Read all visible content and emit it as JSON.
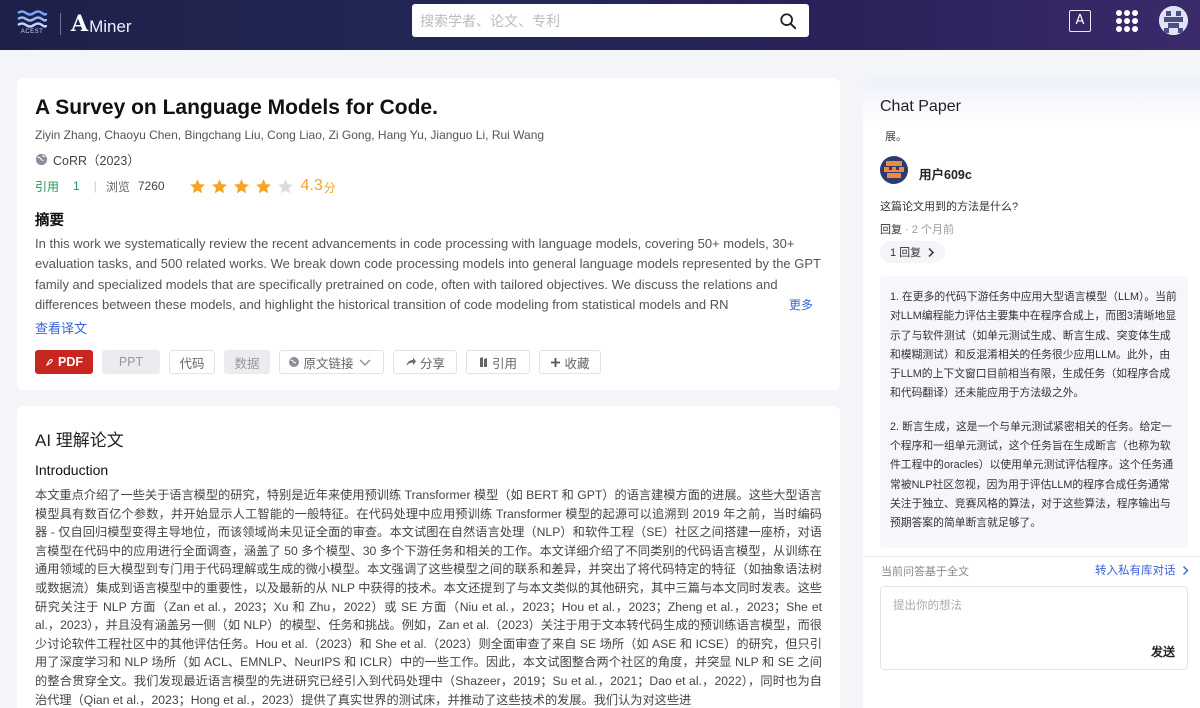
{
  "header": {
    "brand_small": "ACEST",
    "brand_a": "A",
    "brand_name": "Miner",
    "search_placeholder": "搜索学者、论文、专利"
  },
  "paper": {
    "title": "A Survey on Language Models for Code.",
    "authors": [
      "Ziyin Zhang",
      "Chaoyu Chen",
      "Bingchang Liu",
      "Cong Liao",
      "Zi Gong",
      "Hang Yu",
      "Jianguo Li",
      "Rui Wang"
    ],
    "venue": "CoRR（2023）",
    "cite_label": "引用",
    "cite_count": "1",
    "view_label": "浏览",
    "view_count": "7260",
    "rating": 4.3,
    "rating_text": "4.3",
    "rating_unit": "分",
    "stars_filled": 4,
    "stars_total": 5,
    "abstract_heading": "摘要",
    "abstract": "In this work we systematically review the recent advancements in code processing with language models, covering 50+ models, 30+ evaluation tasks, and 500 related works. We break down code processing models into general language models represented by the GPT family and specialized models that are specifically pretrained on code, often with tailored objectives. We discuss the relations and differences between these models, and highlight the historical transition of code modeling from statistical models and RN",
    "more_label": "更多",
    "translate_label": "查看译文",
    "buttons": {
      "pdf": "PDF",
      "ppt": "PPT",
      "code": "代码",
      "data": "数据",
      "source": "原文链接",
      "share": "分享",
      "cite": "引用",
      "favorite": "收藏"
    }
  },
  "ai": {
    "heading": "AI 理解论文",
    "intro_heading": "Introduction",
    "intro_text": "本文重点介绍了一些关于语言模型的研究，特别是近年来使用预训练 Transformer 模型（如 BERT 和 GPT）的语言建模方面的进展。这些大型语言模型具有数百亿个参数，并开始显示人工智能的一般特征。在代码处理中应用预训练 Transformer 模型的起源可以追溯到 2019 年之前，当时编码器 - 仅自回归模型变得主导地位，而该领域尚未见证全面的审查。本文试图在自然语言处理（NLP）和软件工程（SE）社区之间搭建一座桥，对语言模型在代码中的应用进行全面调查，涵盖了 50 多个模型、30 多个下游任务和相关的工作。本文详细介绍了不同类别的代码语言模型，从训练在通用领域的巨大模型到专门用于代码理解或生成的微小模型。本文强调了这些模型之间的联系和差异，并突出了将代码特定的特征（如抽象语法树或数据流）集成到语言模型中的重要性，以及最新的从 NLP 中获得的技术。本文还提到了与本文类似的其他研究，其中三篇与本文同时发表。这些研究关注于 NLP 方面（Zan et al.，2023；Xu 和 Zhu，2022）或 SE 方面（Niu et al.，2023；Hou et al.，2023；Zheng et al.，2023；She et al.，2023），并且没有涵盖另一侧（如 NLP）的模型、任务和挑战。例如，Zan et al.（2023）关注于用于文本转代码生成的预训练语言模型，而很少讨论软件工程社区中的其他评估任务。Hou et al.（2023）和 She et al.（2023）则全面审查了来自 SE 场所（如 ASE 和 ICSE）的研究，但只引用了深度学习和 NLP 场所（如 ACL、EMNLP、NeurIPS 和 ICLR）中的一些工作。因此，本文试图整合两个社区的角度，并突显 NLP 和 SE 之间的整合贯穿全文。我们发现最近语言模型的先进研究已经引入到代码处理中（Shazeer，2019；Su et al.，2021；Dao et al.，2022），同时也为自治代理（Qian et al.，2023；Hong et al.，2023）提供了真实世界的测试床，并推动了这些技术的发展。我们认为对这些进"
  },
  "chat": {
    "title": "Chat Paper",
    "fragment": "展。",
    "user_name": "用户609c",
    "question": "这篇论文用到的方法是什么?",
    "reply_label": "回复",
    "reply_time": "· 2 个月前",
    "reply_count": "1 回复",
    "answer_p1": "1. 在更多的代码下游任务中应用大型语言模型（LLM）。当前对LLM编程能力评估主要集中在程序合成上，而图3清晰地显示了与软件测试（如单元测试生成、断言生成、突变体生成和模糊测试）和反混淆相关的任务很少应用LLM。此外，由于LLM的上下文窗口目前相当有限，生成任务（如程序合成和代码翻译）还未能应用于方法级之外。",
    "answer_p2": "2. 断言生成，这是一个与单元测试紧密相关的任务。给定一个程序和一组单元测试，这个任务旨在生成断言（也称为软件工程中的oracles）以使用单元测试评估程序。这个任务通常被NLP社区忽视，因为用于评估LLM的程序合成任务通常关注于独立、竞赛风格的算法，对于这些算法，程序输出与预期答案的简单断言就足够了。",
    "footer_note": "当前问答基于全文",
    "private_link": "转入私有库对话",
    "input_placeholder": "提出你的想法",
    "send_label": "发送"
  },
  "colors": {
    "header_bg": "#232756",
    "accent_green": "#1a9a5b",
    "star": "#f3a529",
    "pdf_red": "#c8271f",
    "link_blue": "#3a64d8"
  }
}
